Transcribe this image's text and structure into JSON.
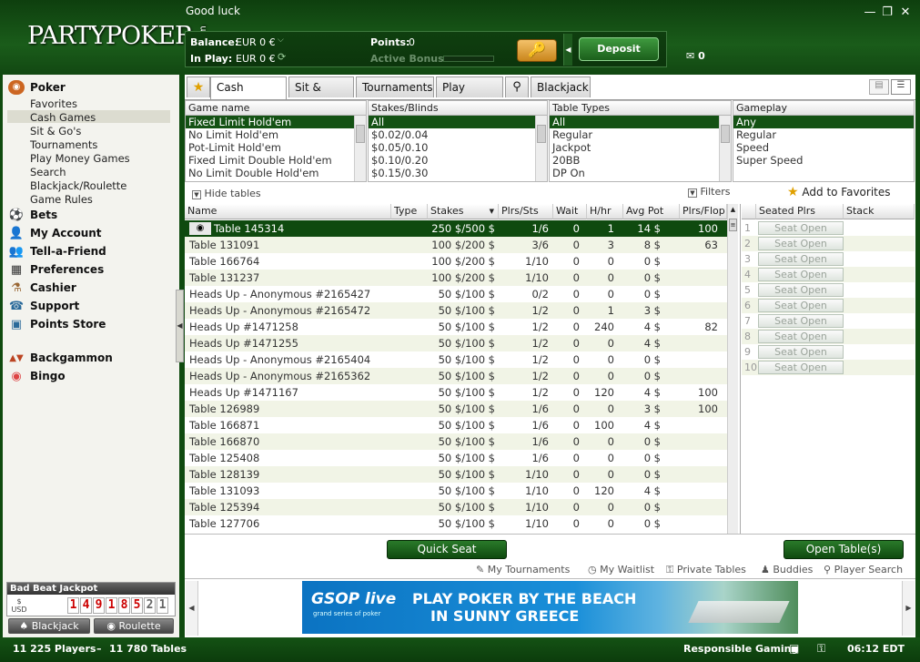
{
  "header": {
    "logo": "PARTYPOKER",
    "logo_suffix": ".com",
    "greeting": "Good luck",
    "balance_label": "Balance:",
    "balance_value": "EUR  0 €",
    "inplay_label": "In Play:",
    "inplay_value": "EUR  0 €",
    "points_label": "Points:",
    "points_value": "0",
    "bonus_label": "Active Bonus:",
    "deposit_label": "Deposit",
    "mail_count": "0"
  },
  "sidebar": {
    "poker": "Poker",
    "poker_items": [
      "Favorites",
      "Cash Games",
      "Sit & Go's",
      "Tournaments",
      "Play Money Games",
      "Search",
      "Blackjack/Roulette",
      "Game Rules"
    ],
    "sections": [
      "Bets",
      "My Account",
      "Tell-a-Friend",
      "Preferences",
      "Cashier",
      "Support",
      "Points Store"
    ],
    "extras": [
      "Backgammon",
      "Bingo"
    ],
    "jackpot_title": "Bad Beat Jackpot",
    "jackpot_currency": "USD",
    "jackpot_digits": [
      "1",
      "4",
      "9",
      "1",
      "8",
      "5",
      "2",
      "1"
    ],
    "blackjack_btn": "Blackjack",
    "roulette_btn": "Roulette"
  },
  "tabs": [
    "Cash Games",
    "Sit & Go's",
    "Tournaments",
    "Play Money",
    "Blackjack"
  ],
  "filters": {
    "game_name": {
      "header": "Game name",
      "items": [
        "Fixed Limit Hold'em",
        "No Limit Hold'em",
        "Pot-Limit Hold'em",
        "Fixed Limit Double Hold'em",
        "No Limit Double Hold'em"
      ]
    },
    "stakes": {
      "header": "Stakes/Blinds",
      "items": [
        "All",
        "$0.02/0.04",
        "$0.05/0.10",
        "$0.10/0.20",
        "$0.15/0.30"
      ]
    },
    "table_types": {
      "header": "Table Types",
      "items": [
        "All",
        "Regular",
        "Jackpot",
        "20BB",
        "DP On"
      ]
    },
    "gameplay": {
      "header": "Gameplay",
      "items": [
        "Any",
        "Regular",
        "Speed",
        "Super Speed"
      ]
    },
    "hide_tables": "Hide tables",
    "filters_label": "Filters",
    "add_favorites": "Add to Favorites"
  },
  "table_headers": [
    "Name",
    "Type",
    "Stakes",
    "Plrs/Sts",
    "Wait",
    "H/hr",
    "Avg Pot",
    "Plrs/Flop"
  ],
  "tables": [
    {
      "name": "Table  145314",
      "stakes": "250 $/500 $",
      "plrs": "1/6",
      "wait": "0",
      "hhr": "1",
      "pot": "14 $",
      "flop": "100"
    },
    {
      "name": "Table  131091",
      "stakes": "100 $/200 $",
      "plrs": "3/6",
      "wait": "0",
      "hhr": "3",
      "pot": "8 $",
      "flop": "63"
    },
    {
      "name": "Table  166764",
      "stakes": "100 $/200 $",
      "plrs": "1/10",
      "wait": "0",
      "hhr": "0",
      "pot": "0 $",
      "flop": ""
    },
    {
      "name": "Table  131237",
      "stakes": "100 $/200 $",
      "plrs": "1/10",
      "wait": "0",
      "hhr": "0",
      "pot": "0 $",
      "flop": ""
    },
    {
      "name": "Heads Up - Anonymous #2165427",
      "stakes": "50 $/100 $",
      "plrs": "0/2",
      "wait": "0",
      "hhr": "0",
      "pot": "0 $",
      "flop": ""
    },
    {
      "name": "Heads Up - Anonymous #2165472",
      "stakes": "50 $/100 $",
      "plrs": "1/2",
      "wait": "0",
      "hhr": "1",
      "pot": "3 $",
      "flop": ""
    },
    {
      "name": "Heads Up #1471258",
      "stakes": "50 $/100 $",
      "plrs": "1/2",
      "wait": "0",
      "hhr": "240",
      "pot": "4 $",
      "flop": "82"
    },
    {
      "name": "Heads Up #1471255",
      "stakes": "50 $/100 $",
      "plrs": "1/2",
      "wait": "0",
      "hhr": "0",
      "pot": "4 $",
      "flop": ""
    },
    {
      "name": "Heads Up - Anonymous #2165404",
      "stakes": "50 $/100 $",
      "plrs": "1/2",
      "wait": "0",
      "hhr": "0",
      "pot": "0 $",
      "flop": ""
    },
    {
      "name": "Heads Up - Anonymous #2165362",
      "stakes": "50 $/100 $",
      "plrs": "1/2",
      "wait": "0",
      "hhr": "0",
      "pot": "0 $",
      "flop": ""
    },
    {
      "name": "Heads Up #1471167",
      "stakes": "50 $/100 $",
      "plrs": "1/2",
      "wait": "0",
      "hhr": "120",
      "pot": "4 $",
      "flop": "100"
    },
    {
      "name": "Table  126989",
      "stakes": "50 $/100 $",
      "plrs": "1/6",
      "wait": "0",
      "hhr": "0",
      "pot": "3 $",
      "flop": "100"
    },
    {
      "name": "Table  166871",
      "stakes": "50 $/100 $",
      "plrs": "1/6",
      "wait": "0",
      "hhr": "100",
      "pot": "4 $",
      "flop": ""
    },
    {
      "name": "Table  166870",
      "stakes": "50 $/100 $",
      "plrs": "1/6",
      "wait": "0",
      "hhr": "0",
      "pot": "0 $",
      "flop": ""
    },
    {
      "name": "Table  125408",
      "stakes": "50 $/100 $",
      "plrs": "1/6",
      "wait": "0",
      "hhr": "0",
      "pot": "0 $",
      "flop": ""
    },
    {
      "name": "Table  128139",
      "stakes": "50 $/100 $",
      "plrs": "1/10",
      "wait": "0",
      "hhr": "0",
      "pot": "0 $",
      "flop": ""
    },
    {
      "name": "Table  131093",
      "stakes": "50 $/100 $",
      "plrs": "1/10",
      "wait": "0",
      "hhr": "120",
      "pot": "4 $",
      "flop": ""
    },
    {
      "name": "Table  125394",
      "stakes": "50 $/100 $",
      "plrs": "1/10",
      "wait": "0",
      "hhr": "0",
      "pot": "0 $",
      "flop": ""
    },
    {
      "name": "Table  127706",
      "stakes": "50 $/100 $",
      "plrs": "1/10",
      "wait": "0",
      "hhr": "0",
      "pot": "0 $",
      "flop": ""
    }
  ],
  "seat_headers": [
    "Seated Plrs",
    "Stack"
  ],
  "seats": [
    "1",
    "2",
    "3",
    "4",
    "5",
    "6",
    "7",
    "8",
    "9",
    "10"
  ],
  "seat_open_label": "Seat Open",
  "buttons": {
    "quick_seat": "Quick Seat",
    "open_tables": "Open Table(s)"
  },
  "footer_links": [
    "My Tournaments",
    "My Waitlist",
    "Private Tables",
    "Buddies",
    "Player Search"
  ],
  "banner": {
    "brand": "GSOP live",
    "brand_sub": "grand series of poker",
    "line1": "PLAY POKER BY THE BEACH",
    "line2": "IN SUNNY GREECE"
  },
  "status": {
    "players": "11 225 Players",
    "tables": "11 780 Tables",
    "responsible": "Responsible Gaming",
    "time": "06:12 EDT"
  },
  "colors": {
    "brand_green": "#0f4a0f",
    "selected_row": "#0f4a0f",
    "deposit": "#2a7a2a"
  }
}
